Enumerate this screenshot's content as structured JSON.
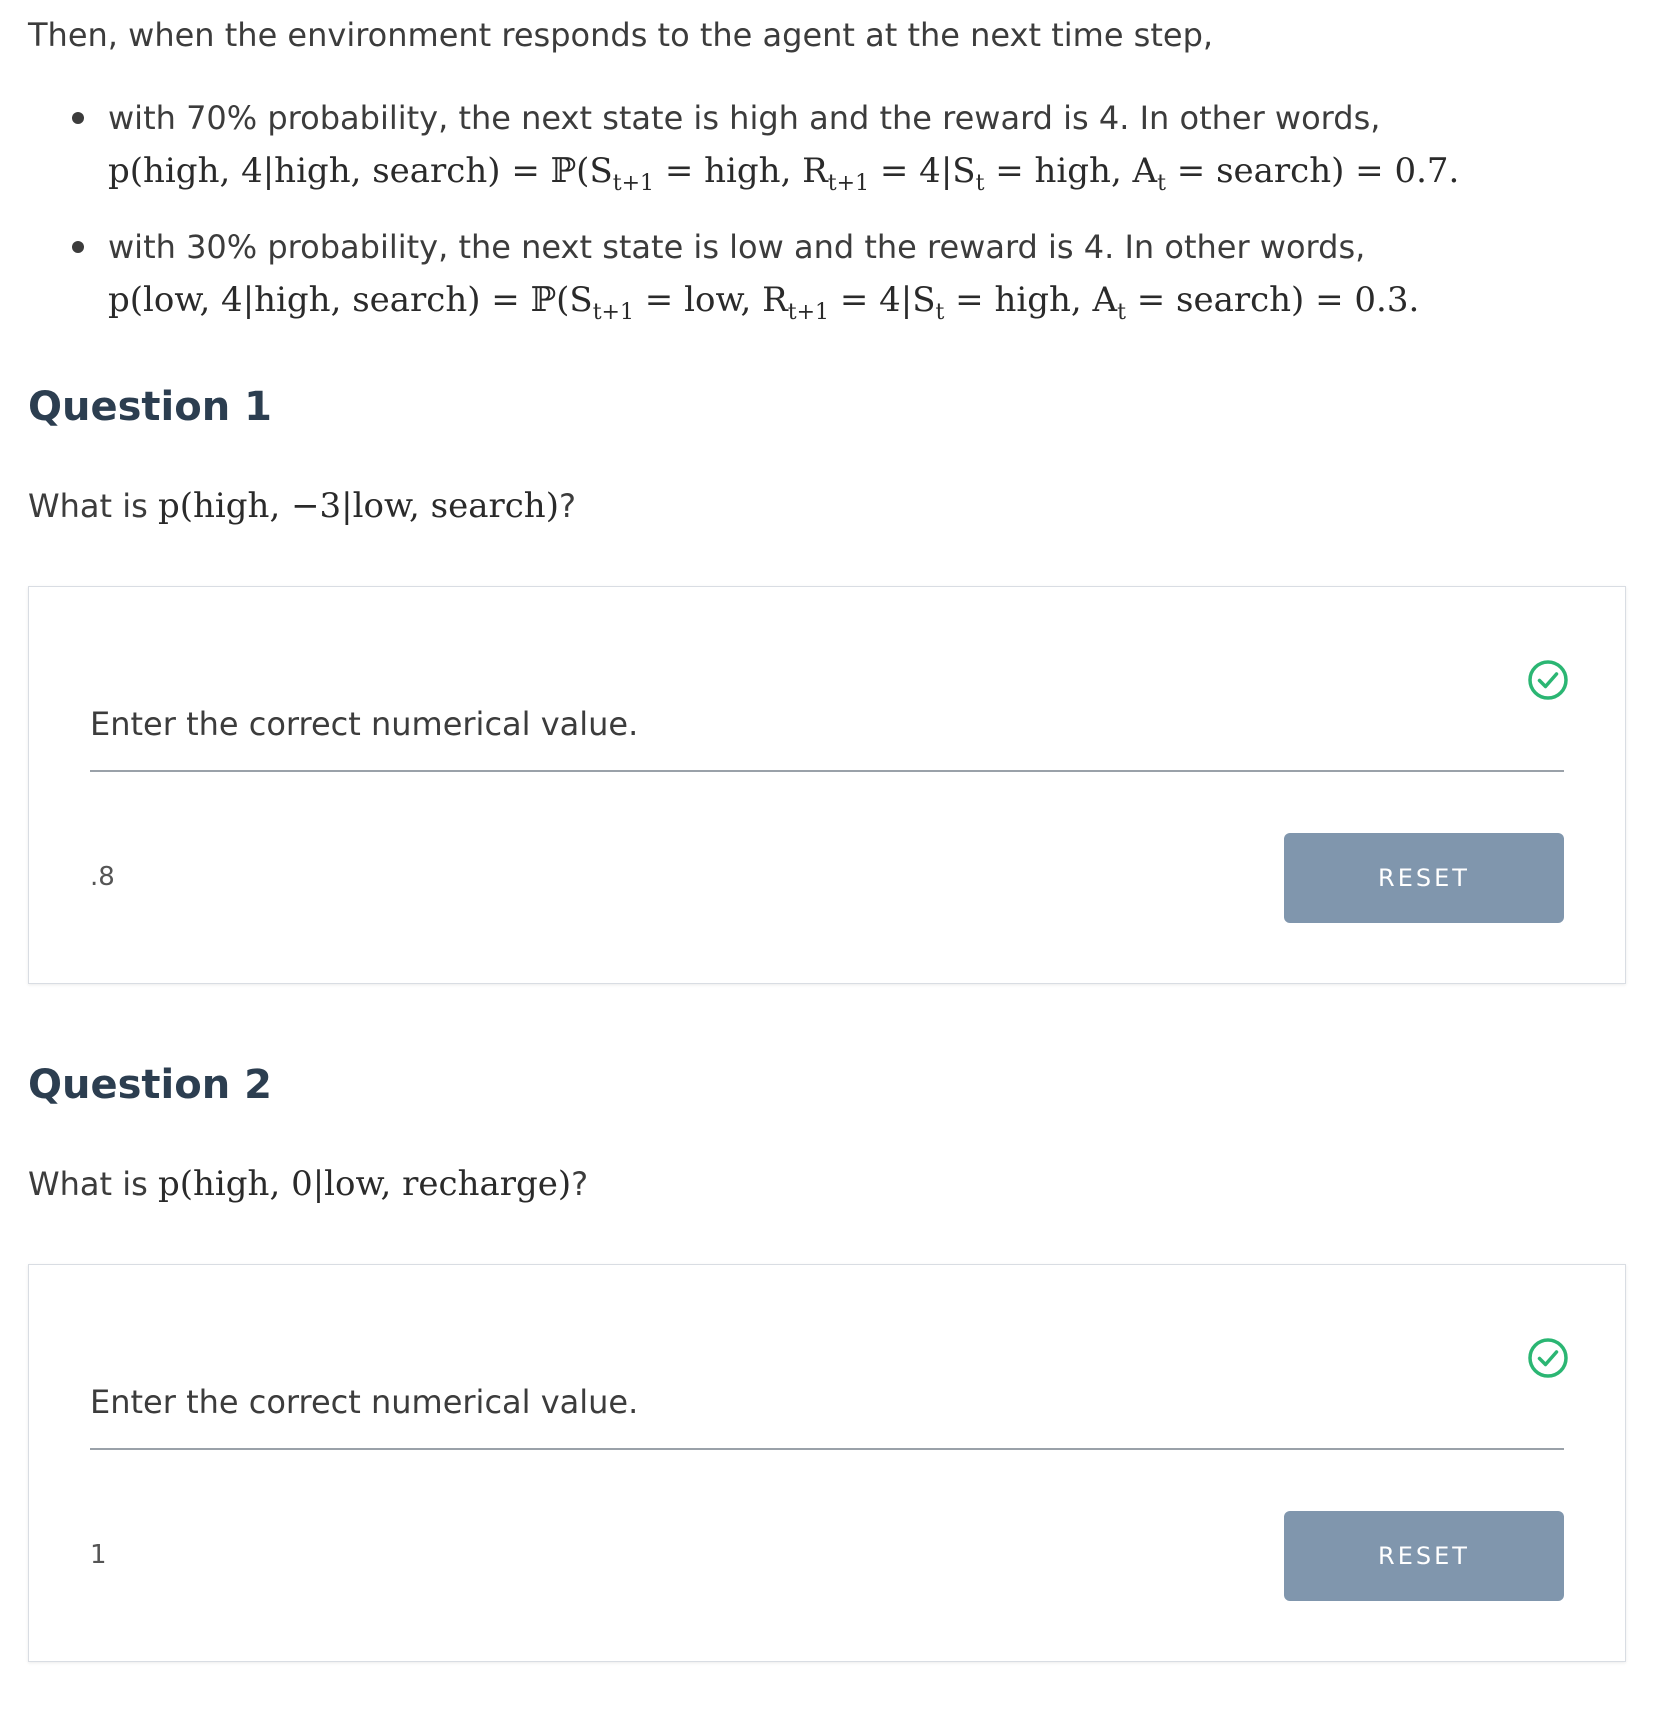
{
  "intro": "Then, when the environment responds to the agent at the next time step,",
  "bullets": [
    {
      "text": "with 70% probability, the next state is high and the reward is 4. In other words,",
      "math": "p(high, 4|high, search) = ℙ(S<sub>t+1</sub> = high, R<sub>t+1</sub> = 4|S<sub>t</sub> = high, A<sub>t</sub> = search) = 0.7."
    },
    {
      "text": "with 30% probability, the next state is low and the reward is 4. In other words,",
      "math": "p(low, 4|high, search) = ℙ(S<sub>t+1</sub> = low, R<sub>t+1</sub> = 4|S<sub>t</sub> = high, A<sub>t</sub> = search) = 0.3."
    }
  ],
  "questions": [
    {
      "title": "Question 1",
      "prompt_prefix": "What is ",
      "prompt_math": "p(high, −3|low, search)",
      "prompt_suffix": "?",
      "answer_label": "Enter the correct numerical value.",
      "answer_value": ".8",
      "reset_label": "RESET",
      "status_icon": "check-circle-icon",
      "status_color": "#2bb673"
    },
    {
      "title": "Question 2",
      "prompt_prefix": "What is ",
      "prompt_math": "p(high, 0|low, recharge)",
      "prompt_suffix": "?",
      "answer_label": "Enter the correct numerical value.",
      "answer_value": "1",
      "reset_label": "RESET",
      "status_icon": "check-circle-icon",
      "status_color": "#2bb673"
    }
  ],
  "colors": {
    "reset_button": "#8096ad",
    "heading": "#2c3e50",
    "check": "#2bb673"
  }
}
